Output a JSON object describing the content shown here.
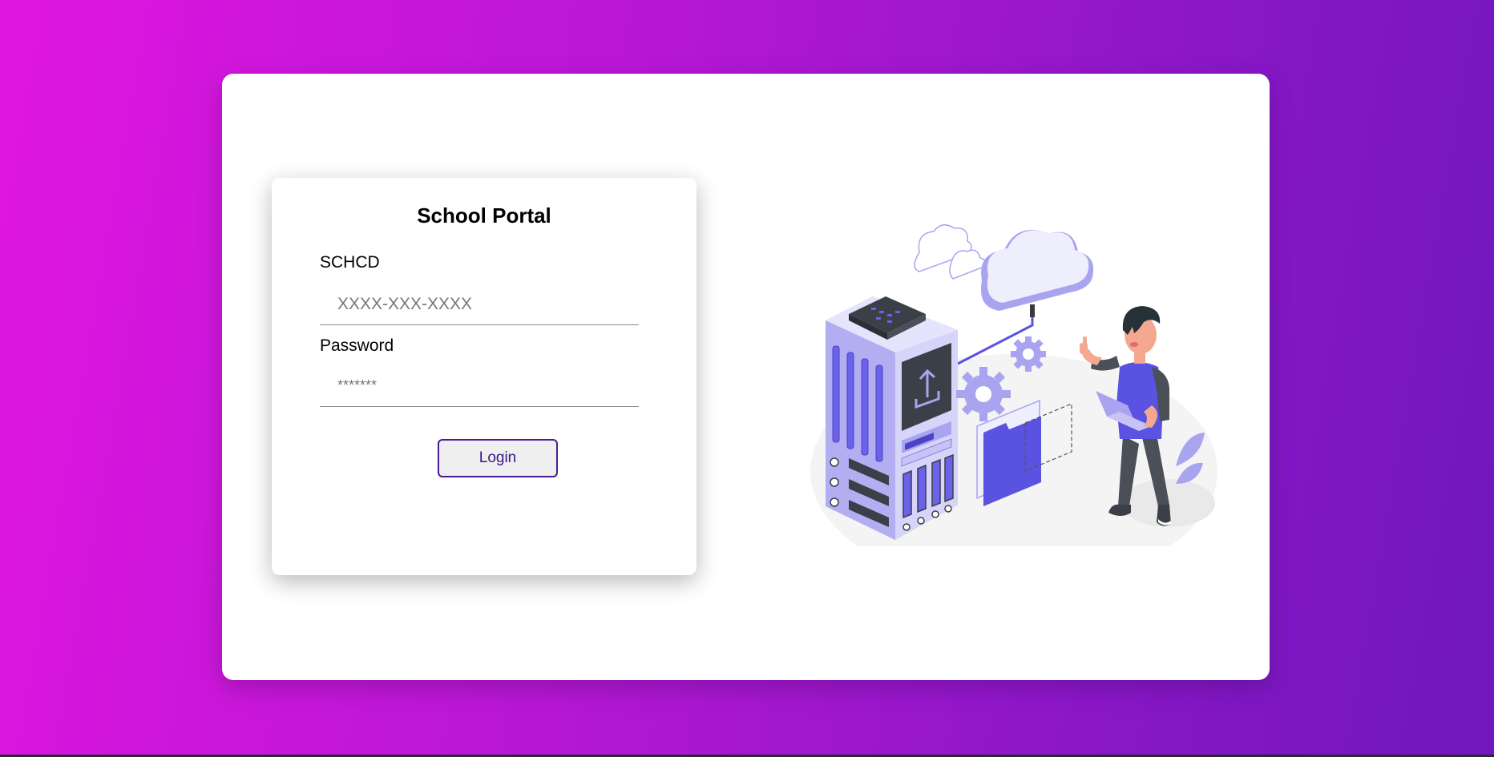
{
  "login": {
    "title": "School Portal",
    "schcd_label": "SCHCD",
    "schcd_placeholder": "XXXX-XXX-XXXX",
    "password_label": "Password",
    "password_placeholder": "*******",
    "login_button": "Login"
  },
  "colors": {
    "background_gradient_start": "#e016e0",
    "background_gradient_end": "#6f17bd",
    "button_border": "#4b1a96",
    "illustration_accent": "#6a62e8"
  },
  "illustration": {
    "icons": [
      "server-rack-icon",
      "cloud-icon",
      "gear-icon",
      "folder-icon",
      "person-with-laptop-icon",
      "upload-icon"
    ]
  }
}
